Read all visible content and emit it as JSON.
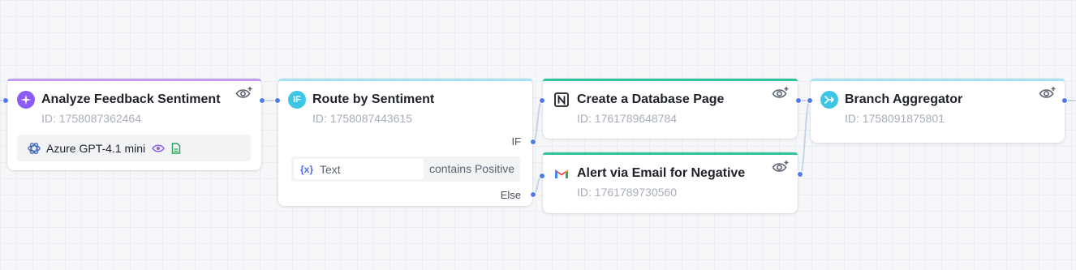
{
  "nodes": [
    {
      "title": "Analyze Feedback Sentiment",
      "id_text": "ID: 1758087362464",
      "icon": "sparkle-icon",
      "accent": "#c49ef5",
      "model": {
        "icon": "openai-icon",
        "label": "Azure GPT-4.1 mini",
        "badges": [
          "vision-eye-icon",
          "document-icon"
        ]
      }
    },
    {
      "title": "Route by Sentiment",
      "id_text": "ID: 1758087443615",
      "icon": "if-icon",
      "icon_text": "IF",
      "accent": "#a6e3ef",
      "condition": {
        "var_symbol": "{x}",
        "variable": "Text",
        "operator": "contains Positive"
      },
      "branches": [
        "IF",
        "Else"
      ]
    },
    {
      "title": "Create a Database Page",
      "id_text": "ID: 1761789648784",
      "icon": "notion-icon",
      "accent": "#2ec4a0"
    },
    {
      "title": "Alert via Email for Negative",
      "id_text": "ID: 1761789730560",
      "icon": "gmail-icon",
      "accent": "#2ec4a0"
    },
    {
      "title": "Branch Aggregator",
      "id_text": "ID: 1758091875801",
      "icon": "merge-icon",
      "accent": "#a6e3ef"
    }
  ],
  "colors": {
    "handle": "#4f7bf0",
    "edge": "#c9d3e6",
    "if_icon_bg": "#3ec6e6",
    "sparkle_bg": "#8b5cf6",
    "merge_bg": "#3ec6e6"
  }
}
